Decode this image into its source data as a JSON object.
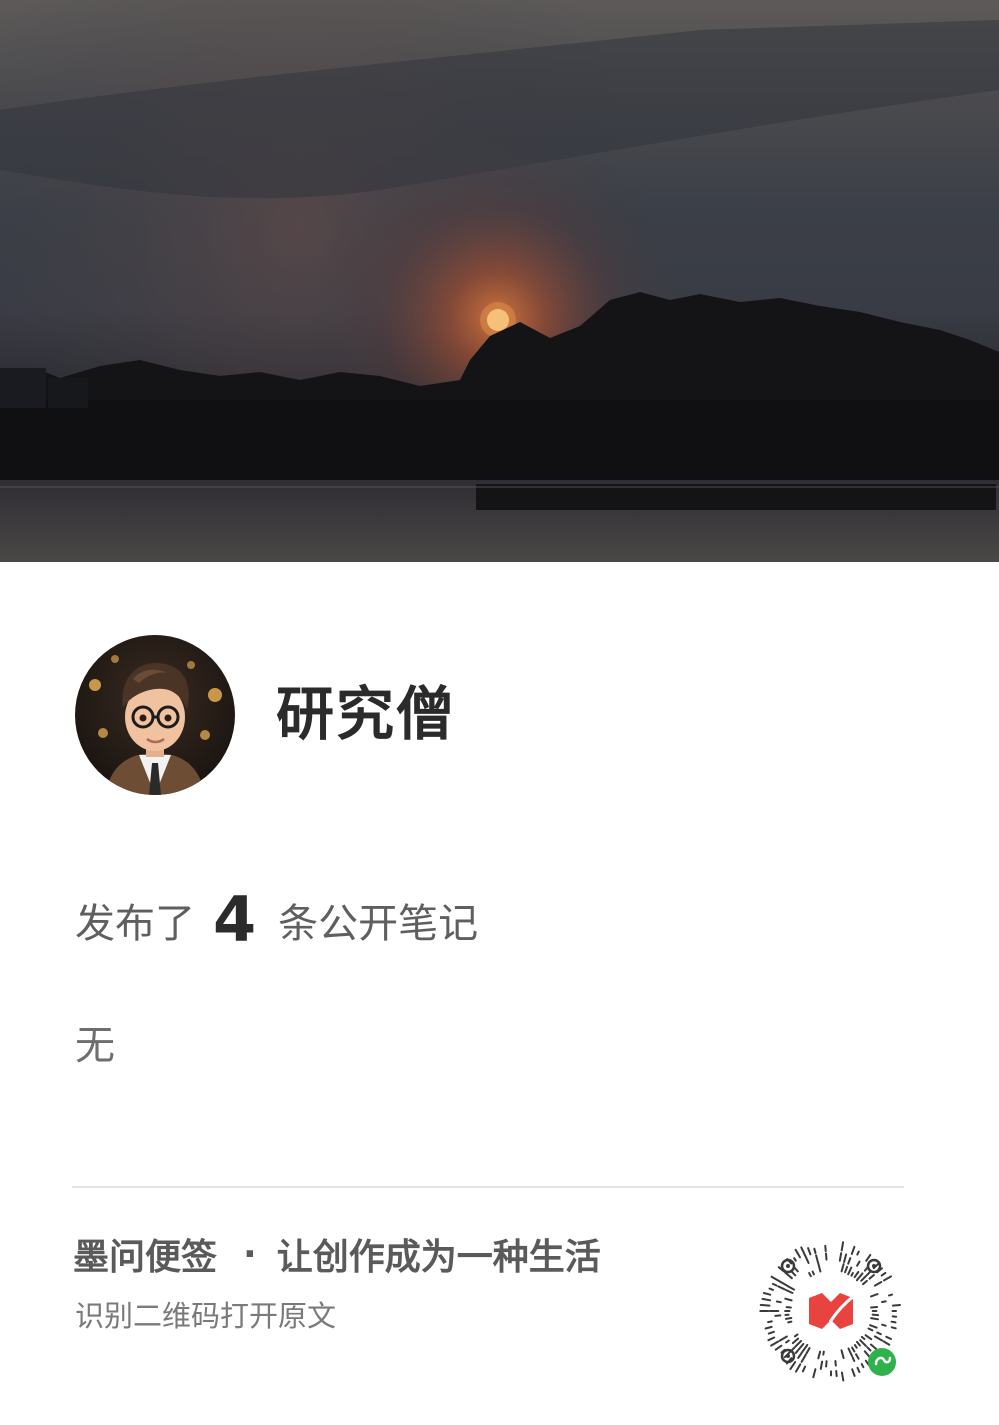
{
  "cover": {
    "alt": "sunset over lake with silhouetted trees"
  },
  "profile": {
    "username": "研究僧"
  },
  "stats": {
    "prefix": "发布了",
    "count": "4",
    "suffix": "条公开笔记"
  },
  "description": "无",
  "footer": {
    "brand": "墨问便签",
    "separator": "·",
    "slogan": "让创作成为一种生活",
    "hint": "识别二维码打开原文"
  },
  "colors": {
    "accent_red": "#e8433e",
    "badge_green": "#2fb24c"
  }
}
